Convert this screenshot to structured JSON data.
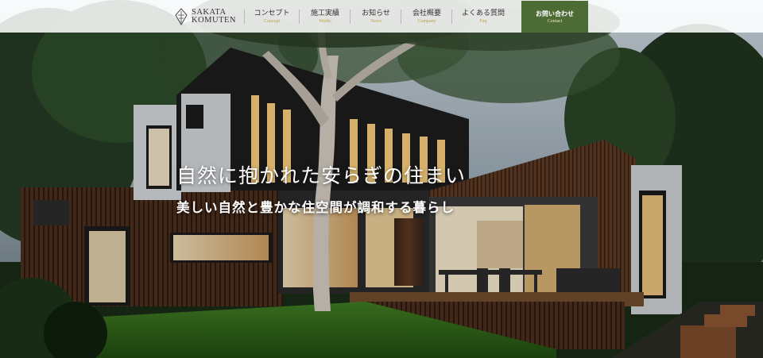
{
  "site": {
    "logo_line1": "SAKATA",
    "logo_line2": "KOMUTEN"
  },
  "nav": [
    {
      "jp": "コンセプト",
      "en": "Concept"
    },
    {
      "jp": "施工実績",
      "en": "Works"
    },
    {
      "jp": "お知らせ",
      "en": "News"
    },
    {
      "jp": "会社概要",
      "en": "Company"
    },
    {
      "jp": "よくある質問",
      "en": "Faq"
    }
  ],
  "contact": {
    "jp": "お問い合わせ",
    "en": "Contact"
  },
  "hero": {
    "headline": "自然に抱かれた安らぎの住まい",
    "subline": "美しい自然と豊かな住空間が調和する暮らし"
  },
  "colors": {
    "contact_bg": "#4d6b34",
    "nav_en_gold": "#b9a14a",
    "topbar_bg": "#ffffff"
  }
}
